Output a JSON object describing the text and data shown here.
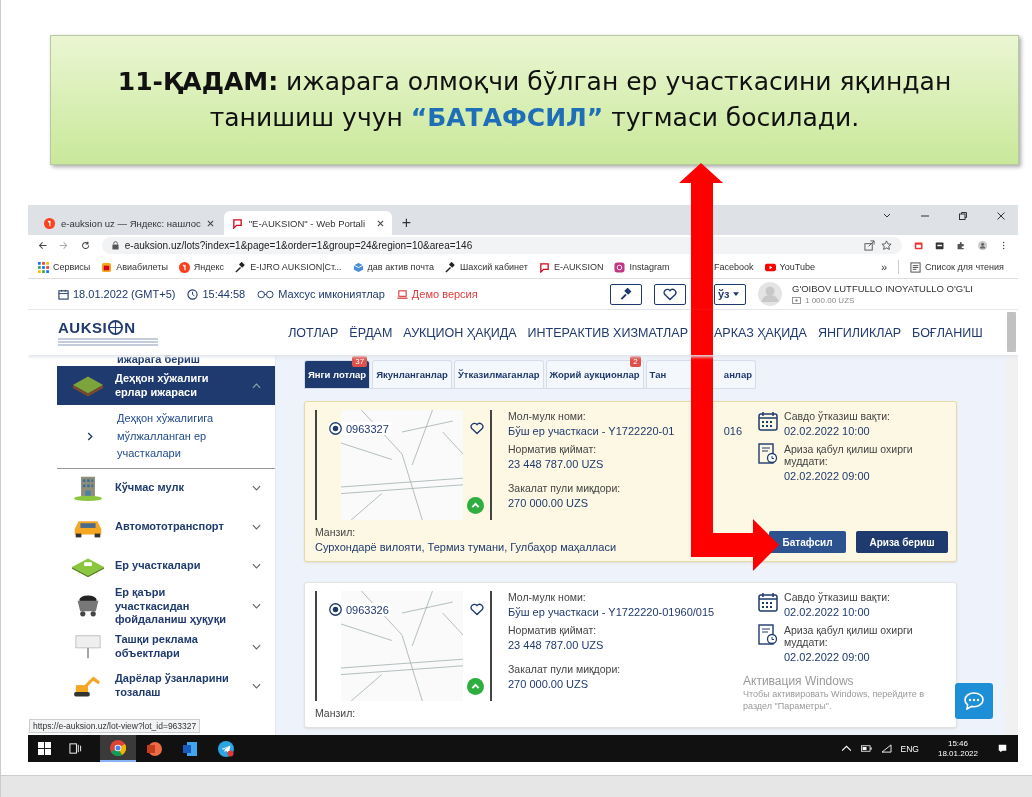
{
  "callout": {
    "text": "**11-ҚАДАМ:** ижарага олмоқчи бўлган ер участкасини яқиндан танишиш учун **“БАТАФСИЛ”** тугмаси босилади."
  },
  "browser_tabs": [
    {
      "title": "e-auksion uz — Яндекс: нашлос",
      "selected": false
    },
    {
      "title": "\"E-AUKSION\" - Web Portali",
      "selected": true
    }
  ],
  "new_tab": "+",
  "address": "e-auksion.uz/lots?index=1&page=1&order=1&group=24&region=10&area=146",
  "bookmarks": [
    "Сервисы",
    "Авиабилеты",
    "Яндекс",
    "E-IJRO AUKSION|Ст...",
    "дав актив почта",
    "Шахсий кабинет",
    "E-AUKSION",
    "Instagram"
  ],
  "bookmarks_after": [
    "Facebook",
    "YouTube"
  ],
  "more_bookmarks": "»",
  "reading_list": "Список для чтения",
  "topbar": {
    "date": "18.01.2022 (GMT+5)",
    "time": "15:44:58",
    "accessibility": "Махсус имкониятлар",
    "demo": "Демо версия",
    "language": "ўз",
    "user": "G'OIBOV LUTFULLO INOYATULLO O'G'LI",
    "balance": "1 000.00 UZS"
  },
  "logo": {
    "text": "AUKSI",
    "tail": "N"
  },
  "nav": [
    "ЛОТЛАР",
    "ЁРДАМ",
    "АУКЦИОН ҲАҚИДА",
    "ИНТЕРАКТИВ ХИЗМАТЛАР"
  ],
  "nav_after": [
    "АРКАЗ ҲАҚИДА",
    "ЯНГИЛИКЛАР",
    "БОҒЛАНИШ"
  ],
  "sidebar": {
    "cut_item": "ижарага бериш",
    "items": [
      {
        "label": "Деҳқон хўжалиги ерлар ижараси",
        "expanded": true,
        "selected": true,
        "children": [
          {
            "label": "Деҳқон хўжалигига мўлжалланган ер участкалари"
          }
        ]
      },
      {
        "label": "Кўчмас мулк",
        "expanded": false,
        "selected": false
      },
      {
        "label": "Автомототранспорт",
        "expanded": false,
        "selected": false
      },
      {
        "label": "Ер участкалари",
        "expanded": false,
        "selected": false
      },
      {
        "label": "Ер қаъри участкасидан фойдаланиш ҳуқуқи",
        "expanded": false,
        "selected": false
      },
      {
        "label": "Ташқи реклама объектлари",
        "expanded": false,
        "selected": false
      },
      {
        "label": "Дарёлар ўзанларини тозалаш",
        "expanded": false,
        "selected": false
      }
    ]
  },
  "lot_tabs": [
    {
      "label": "Янги лотлар",
      "badge": "37",
      "selected": true
    },
    {
      "label": "Якунланганлар",
      "selected": false
    },
    {
      "label": "Ўтказилмаганлар",
      "selected": false
    },
    {
      "label": "Жорий аукционлар",
      "badge": "2",
      "selected": false
    },
    {
      "label": "Тан",
      "label_tail": "анлар",
      "selected": false
    }
  ],
  "lots": [
    {
      "id": "0963327",
      "highlighted": true,
      "name_label": "Мол-мулк номи:",
      "name": "Бўш ер участкаси - Y1722220-01",
      "name_tail": "016",
      "price_label": "Норматив қиймат:",
      "price": "23 448 787.00 UZS",
      "deposit_label": "Закалат пули миқдори:",
      "deposit": "270 000.00 UZS",
      "trade_label": "Савдо ўтказиш вақти:",
      "trade_time": "02.02.2022 10:00",
      "deadline_label": "Ариза қабул қилиш охирги муддати:",
      "deadline": "02.02.2022 09:00",
      "address_label": "Манзил:",
      "address": "Сурхондарё вилояти, Термиз тумани, Гулбаҳор маҳалласи",
      "buttons": [
        "Батафсил",
        "Ариза бериш"
      ]
    },
    {
      "id": "0963326",
      "highlighted": false,
      "name_label": "Мол-мулк номи:",
      "name": "Бўш ер участкаси - Y1722220-01960/015",
      "price_label": "Норматив қиймат:",
      "price": "23 448 787.00 UZS",
      "deposit_label": "Закалат пули миқдори:",
      "deposit": "270 000.00 UZS",
      "trade_label": "Савдо ўтказиш вақти:",
      "trade_time": "02.02.2022 10:00",
      "deadline_label": "Ариза қабул қилиш охирги муддати:",
      "deadline": "02.02.2022 09:00",
      "address_label": "Манзил:"
    }
  ],
  "activation": {
    "title": "Активация Windows",
    "text": "Чтобы активировать Windows, перейдите в раздел \"Параметры\"."
  },
  "status_url": "https://e-auksion.uz/lot-view?lot_id=963327",
  "taskbar": {
    "apps": [
      {
        "selected": true
      },
      {
        "selected": false
      },
      {
        "selected": false
      },
      {
        "selected": false
      }
    ],
    "language": "ENG",
    "time": "15:46",
    "date": "18.01.2022"
  }
}
